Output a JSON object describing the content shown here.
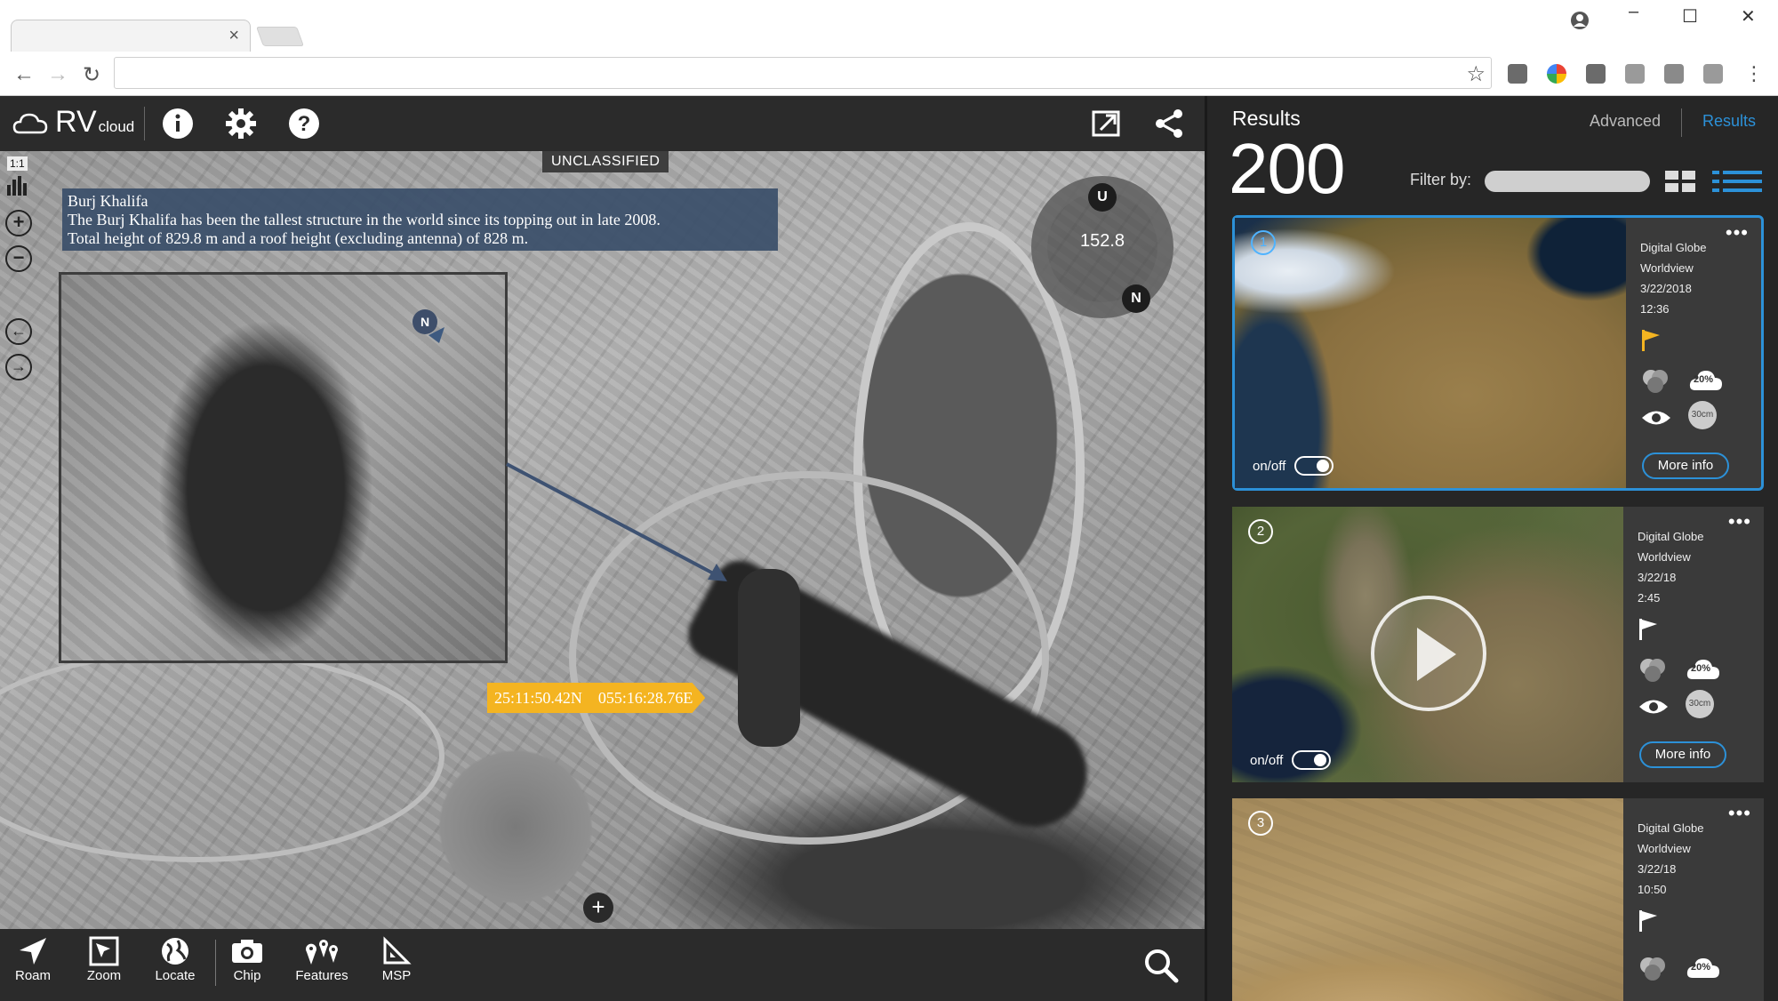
{
  "app": {
    "logo_main": "RV",
    "logo_sub": "cloud"
  },
  "map": {
    "classification": "UNCLASSIFIED",
    "scale": "1:1",
    "info_title": "Burj Khalifa",
    "info_line1": "The Burj Khalifa has been the tallest structure in the world since its topping out in late 2008.",
    "info_line2": "Total height of 829.8 m and a roof height (excluding antenna) of 828 m.",
    "inset_north": "N",
    "compass_value": "152.8",
    "compass_up": "U",
    "compass_north": "N",
    "coord_lat": "25:11:50.42N",
    "coord_lon": "055:16:28.76E"
  },
  "tools": {
    "roam": "Roam",
    "zoom": "Zoom",
    "locate": "Locate",
    "chip": "Chip",
    "features": "Features",
    "msp": "MSP"
  },
  "panel": {
    "title": "Results",
    "count": "200",
    "tab_advanced": "Advanced",
    "tab_results": "Results",
    "filter_label": "Filter by:",
    "accent": "#2c91d8",
    "flag_color": "#f4b421"
  },
  "results": [
    {
      "num": "1",
      "provider": "Digital Globe",
      "sensor": "Worldview",
      "date": "3/22/2018",
      "time": "12:36",
      "cloud": "20%",
      "res": "30cm",
      "toggle": "on/off",
      "more": "More info"
    },
    {
      "num": "2",
      "provider": "Digital Globe",
      "sensor": "Worldview",
      "date": "3/22/18",
      "time": "2:45",
      "cloud": "20%",
      "res": "30cm",
      "toggle": "on/off",
      "more": "More info"
    },
    {
      "num": "3",
      "provider": "Digital Globe",
      "sensor": "Worldview",
      "date": "3/22/18",
      "time": "10:50",
      "cloud": "20%"
    }
  ]
}
